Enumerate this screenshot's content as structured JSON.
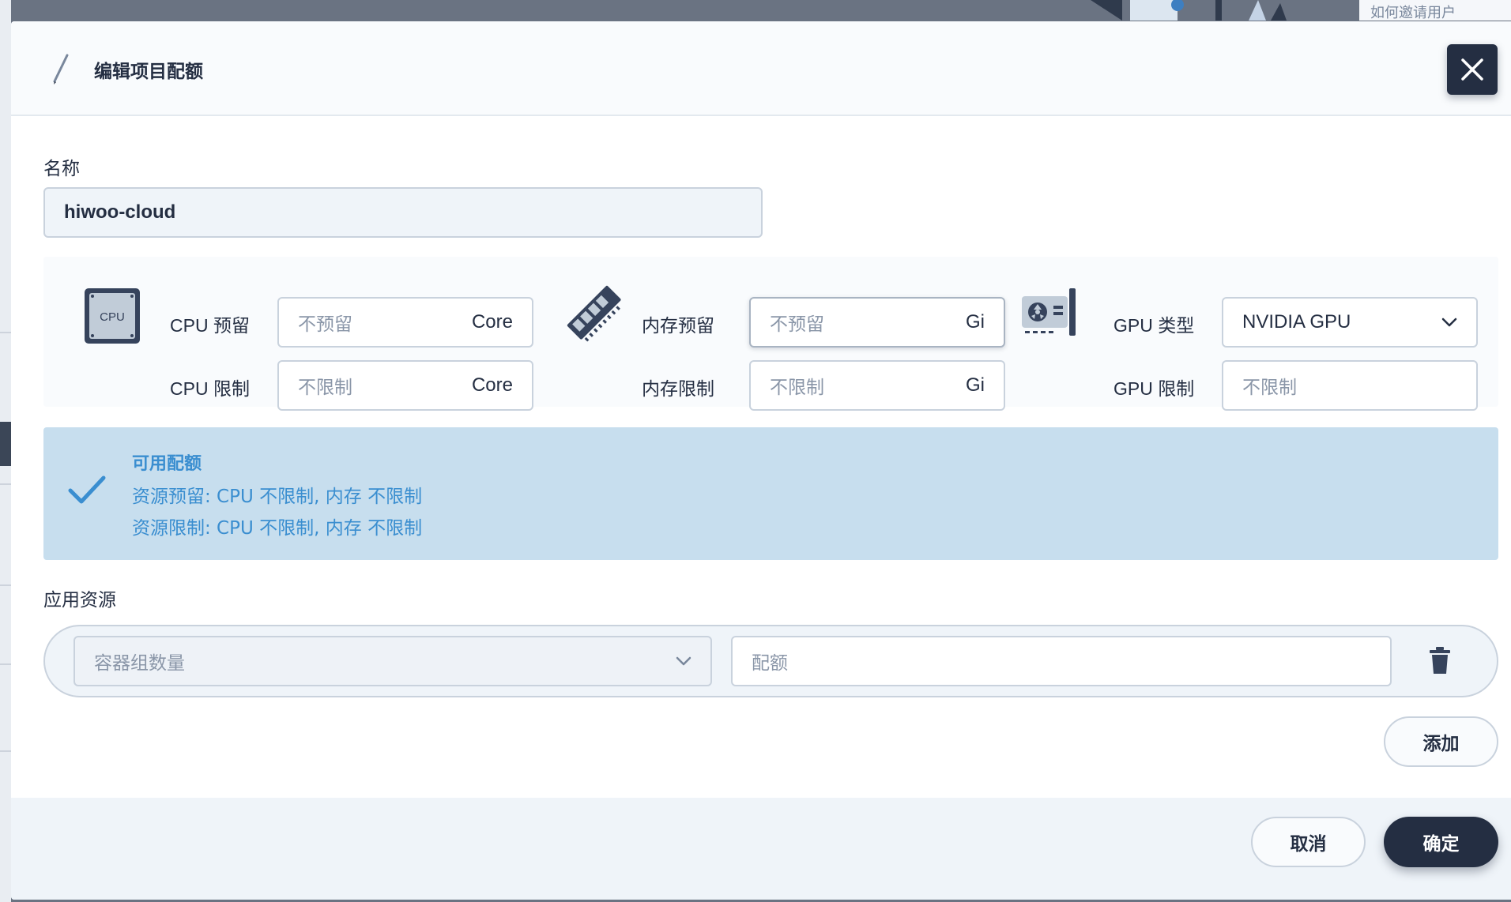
{
  "background": {
    "top_right_link": "如何邀请用户"
  },
  "dialog": {
    "title": "编辑项目配额",
    "close_icon": "close-icon",
    "name": {
      "label": "名称",
      "value": "hiwoo-cloud"
    },
    "cpu": {
      "icon_text": "CPU",
      "reserve_label": "CPU 预留",
      "reserve_placeholder": "不预留",
      "reserve_unit": "Core",
      "limit_label": "CPU 限制",
      "limit_placeholder": "不限制",
      "limit_unit": "Core"
    },
    "memory": {
      "reserve_label": "内存预留",
      "reserve_placeholder": "不预留",
      "reserve_unit": "Gi",
      "limit_label": "内存限制",
      "limit_placeholder": "不限制",
      "limit_unit": "Gi"
    },
    "gpu": {
      "type_label": "GPU 类型",
      "type_value": "NVIDIA GPU",
      "limit_label": "GPU 限制",
      "limit_placeholder": "不限制"
    },
    "available": {
      "title": "可用配额",
      "reserve_line": "资源预留:  CPU 不限制, 内存 不限制",
      "limit_line": "资源限制:  CPU 不限制, 内存 不限制"
    },
    "app_resources": {
      "label": "应用资源",
      "type_placeholder": "容器组数量",
      "quota_placeholder": "配额",
      "add_label": "添加"
    },
    "footer": {
      "cancel_label": "取消",
      "confirm_label": "确定"
    }
  },
  "colors": {
    "primary_dark": "#242e42",
    "info_bg": "#c7deee",
    "info_text": "#3a8ed0"
  }
}
